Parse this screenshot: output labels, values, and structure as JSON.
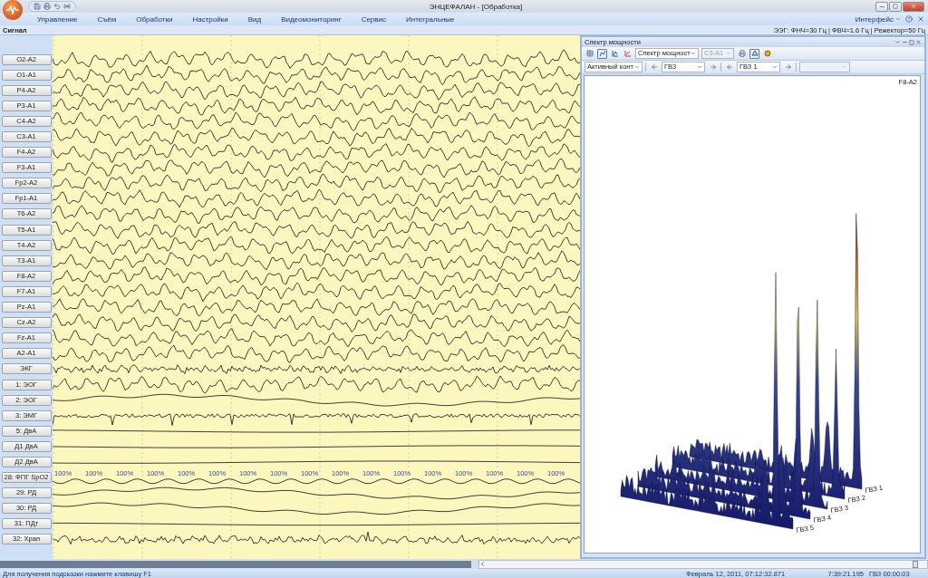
{
  "window": {
    "title": "ЭНЦЕФАЛАН - [Обработка]"
  },
  "menu": {
    "items": [
      "Управление",
      "Съём",
      "Обработки",
      "Настройки",
      "Вид",
      "Видеомониторинг",
      "Сервис",
      "Интегральные"
    ],
    "interface": "Интерфейс"
  },
  "info_bar": {
    "left": "Сигнал",
    "right": "ЭЭГ: ФНЧ=30 Гц | ФВЧ=1.6 Гц | Режектор=50 Гц"
  },
  "channels": [
    {
      "name": "O2-A2",
      "kind": "eeg"
    },
    {
      "name": "O1-A1",
      "kind": "eeg"
    },
    {
      "name": "P4-A2",
      "kind": "eeg"
    },
    {
      "name": "P3-A1",
      "kind": "eeg"
    },
    {
      "name": "C4-A2",
      "kind": "eeg"
    },
    {
      "name": "C3-A1",
      "kind": "eeg"
    },
    {
      "name": "F4-A2",
      "kind": "eeg"
    },
    {
      "name": "F3-A1",
      "kind": "eeg"
    },
    {
      "name": "Fp2-A2",
      "kind": "eeg"
    },
    {
      "name": "Fp1-A1",
      "kind": "eeg"
    },
    {
      "name": "T6-A2",
      "kind": "eeg"
    },
    {
      "name": "T5-A1",
      "kind": "eeg"
    },
    {
      "name": "T4-A2",
      "kind": "eeg"
    },
    {
      "name": "T3-A1",
      "kind": "eeg"
    },
    {
      "name": "F8-A2",
      "kind": "eeg"
    },
    {
      "name": "F7-A1",
      "kind": "eeg"
    },
    {
      "name": "Pz-A1",
      "kind": "eeg"
    },
    {
      "name": "Cz-A2",
      "kind": "eeg"
    },
    {
      "name": "Fz-A1",
      "kind": "eeg"
    },
    {
      "name": "A2-A1",
      "kind": "eeg"
    },
    {
      "name": "ЭКГ",
      "kind": "noise"
    },
    {
      "name": "1: ЭОГ",
      "kind": "eeg"
    },
    {
      "name": "2: ЭОГ",
      "kind": "slow"
    },
    {
      "name": "3: ЭМГ",
      "kind": "ecg"
    },
    {
      "name": "5: ДвА",
      "kind": "flat"
    },
    {
      "name": "Д1 ДвА",
      "kind": "flat"
    },
    {
      "name": "Д2 ДвА",
      "kind": "flat"
    },
    {
      "name": "28: ФПГ SpO2",
      "kind": "pulse"
    },
    {
      "name": "29: РД",
      "kind": "slow"
    },
    {
      "name": "30: РД",
      "kind": "slow"
    },
    {
      "name": "31: ПДт",
      "kind": "flat"
    },
    {
      "name": "32: Храп",
      "kind": "noise"
    }
  ],
  "spo2_marks": [
    "100%",
    "100%",
    "100%",
    "100%",
    "100%",
    "100%",
    "100%",
    "100%",
    "100%",
    "100%",
    "100%",
    "100%",
    "100%",
    "100%",
    "100%",
    "100%",
    "100%"
  ],
  "spectrum_panel": {
    "title": "Спектр мощности",
    "dropdowns": [
      {
        "value": "Спектр мощност",
        "disabled": false
      },
      {
        "value": "C3-A1",
        "disabled": true
      }
    ],
    "selectors": [
      {
        "value": "Активный конт",
        "disabled": false
      },
      {
        "value": "ГВЗ",
        "disabled": false
      },
      {
        "value": "ГВЗ 1",
        "disabled": false
      },
      {
        "disabled": true
      }
    ],
    "channel": "F8-A2",
    "series": [
      "ГВЗ 1",
      "ГВЗ 2",
      "ГВЗ 3",
      "ГВЗ 4",
      "ГВЗ 5"
    ]
  },
  "status_bar": {
    "hint": "Для получения подсказки нажмите клавишу F1",
    "date": "Февраль 12, 2011, 07:12:32.871",
    "time": "7:39:21.195",
    "segment": "ГВЗ 00:00:03"
  }
}
